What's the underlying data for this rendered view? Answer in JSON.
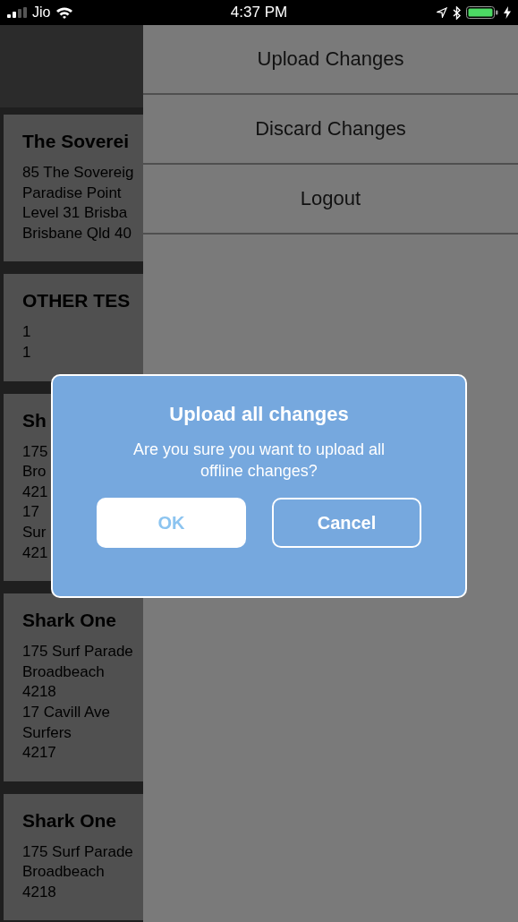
{
  "status_bar": {
    "carrier": "Jio",
    "time": "4:37 PM"
  },
  "cards": [
    {
      "title": "The Soverei",
      "lines": [
        "85 The Sovereig",
        "Paradise Point",
        "Level 31 Brisba",
        "Brisbane Qld 40"
      ]
    },
    {
      "title": "OTHER TES",
      "lines": [
        "1",
        "1"
      ]
    },
    {
      "title": "Sh",
      "lines": [
        "175",
        "Bro",
        "421",
        "17",
        "Sur",
        "421"
      ]
    },
    {
      "title": "Shark One",
      "lines": [
        "175 Surf Parade",
        "Broadbeach",
        "4218",
        "17 Cavill Ave",
        "Surfers",
        "4217"
      ]
    },
    {
      "title": "Shark One",
      "lines": [
        "175 Surf Parade",
        "Broadbeach",
        "4218"
      ]
    }
  ],
  "drawer": {
    "items": [
      {
        "label": "Upload Changes"
      },
      {
        "label": "Discard Changes"
      },
      {
        "label": "Logout"
      }
    ]
  },
  "dialog": {
    "title": "Upload all changes",
    "message": "Are you sure you want to upload all offline changes?",
    "buttons": [
      {
        "label": "OK",
        "kind": "filled"
      },
      {
        "label": "Cancel",
        "kind": "outline"
      }
    ]
  }
}
